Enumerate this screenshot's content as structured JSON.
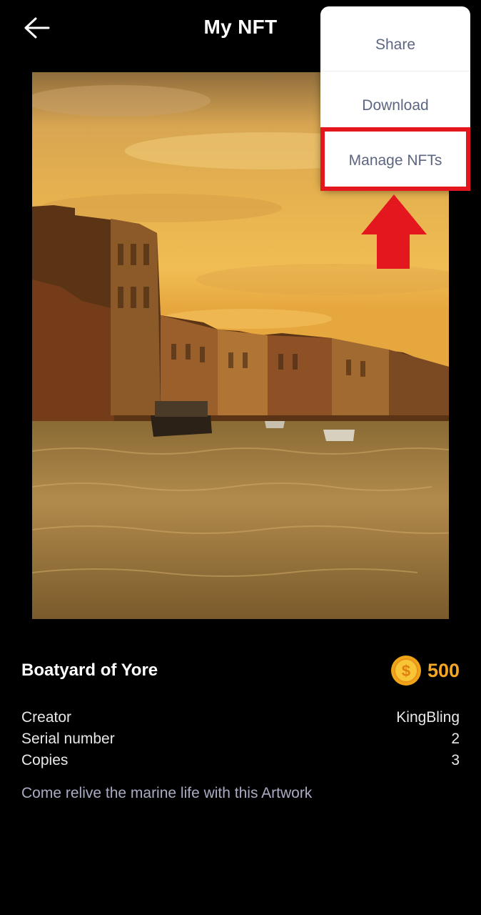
{
  "header": {
    "title": "My NFT",
    "back_icon": "arrow-left-icon"
  },
  "menu": {
    "items": [
      {
        "label": "Share"
      },
      {
        "label": "Download"
      },
      {
        "label": "Manage NFTs"
      }
    ],
    "highlight_color": "#e4161e"
  },
  "nft": {
    "name": "Boatyard of Yore",
    "price": "500",
    "currency_icon": "coin-icon",
    "details": [
      {
        "label": "Creator",
        "value": "KingBling"
      },
      {
        "label": "Serial number",
        "value": "2"
      },
      {
        "label": "Copies",
        "value": "3"
      }
    ],
    "description": "Come relive the marine life with this Artwork"
  },
  "colors": {
    "background": "#000000",
    "price": "#f5a623",
    "menu_text": "#5d6680",
    "description": "#a9acc3"
  }
}
